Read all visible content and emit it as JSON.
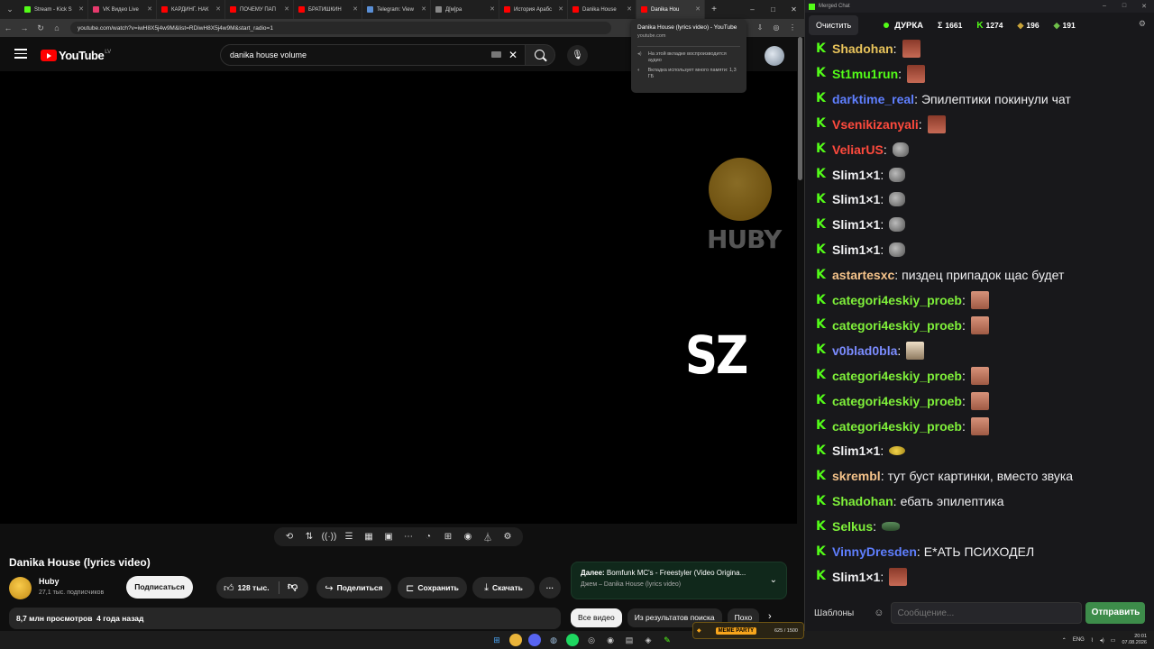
{
  "browser": {
    "tabs": [
      {
        "label": "Stream - Kick S",
        "color": "#53fc18"
      },
      {
        "label": "VK Видео Live",
        "color": "#e63a6d"
      },
      {
        "label": "КАРДИНГ. НАК",
        "color": "#ff0000"
      },
      {
        "label": "ПОЧЕМУ ПАП",
        "color": "#ff0000"
      },
      {
        "label": "БРАТИШКИН",
        "color": "#ff0000"
      },
      {
        "label": "Telegram: View",
        "color": "#5a8fd6"
      },
      {
        "label": "Д[м]ра",
        "color": "#888888"
      },
      {
        "label": "История Арабс",
        "color": "#ff0000"
      },
      {
        "label": "Danika House",
        "color": "#ff0000"
      },
      {
        "label": "Danika Hou",
        "color": "#ff0000"
      }
    ],
    "url": "youtube.com/watch?v=iwH8X5j4w9M&list=RDiwH8X5j4w9M&start_radio=1",
    "tooltip": {
      "title": "Danika House (lyrics video) - YouTube",
      "domain": "youtube.com",
      "audio_note": "На этой вкладке воспроизводится аудио",
      "memory_note": "Вкладка использует много памяти: 1,3 ГБ"
    }
  },
  "youtube": {
    "logo": "YouTube",
    "logo_country": "LV",
    "search_value": "danika house volume",
    "video_overlay": {
      "channel_mark": "HUBY",
      "caption": "SZ"
    },
    "video_title": "Danika House (lyrics video)",
    "channel": {
      "name": "Huby",
      "subscribers": "27,1 тыс. подписчиков"
    },
    "subscribe_label": "Подписаться",
    "likes": "128 тыс.",
    "share_label": "Поделиться",
    "save_label": "Сохранить",
    "download_label": "Скачать",
    "views_line": "8,7 млн просмотров  4 года назад",
    "next": {
      "prefix": "Далее:",
      "title": "Bomfunk MC's - Freestyler (Video Origina...",
      "subtitle": "Джем – Danika House (lyrics video)"
    },
    "chips": [
      "Все видео",
      "Из результатов поиска",
      "Похо"
    ]
  },
  "chat": {
    "window_title": "Merged Chat",
    "clear_label": "Очистить",
    "channel": "ДУРКА",
    "stats": {
      "total": "1661",
      "kick": "1274",
      "twitch": "196",
      "other": "191"
    },
    "messages": [
      {
        "user": "Shadohan",
        "color": "#e9c45b",
        "text": "",
        "emote": "e-face"
      },
      {
        "user": "St1mu1run",
        "color": "#53fc18",
        "text": "",
        "emote": "e-face"
      },
      {
        "user": "darktime_real",
        "color": "#5f7fff",
        "text": "Эпилептики покинули чат",
        "emote": ""
      },
      {
        "user": "Vsenikizanyali",
        "color": "#ff4a3d",
        "text": "",
        "emote": "e-face"
      },
      {
        "user": "VeliarUS",
        "color": "#ff4a3d",
        "text": "",
        "emote": "e-rock"
      },
      {
        "user": "Slim1×1",
        "color": "#efeff1",
        "text": "",
        "emote": "e-rock"
      },
      {
        "user": "Slim1×1",
        "color": "#efeff1",
        "text": "",
        "emote": "e-rock"
      },
      {
        "user": "Slim1×1",
        "color": "#efeff1",
        "text": "",
        "emote": "e-rock"
      },
      {
        "user": "Slim1×1",
        "color": "#efeff1",
        "text": "",
        "emote": "e-rock"
      },
      {
        "user": "astartesxc",
        "color": "#f5c38a",
        "text": "пиздец припадок щас будет",
        "emote": ""
      },
      {
        "user": "categori4eskiy_proeb",
        "color": "#7ff03a",
        "text": "",
        "emote": "e-man"
      },
      {
        "user": "categori4eskiy_proeb",
        "color": "#7ff03a",
        "text": "",
        "emote": "e-man"
      },
      {
        "user": "v0blad0bla",
        "color": "#7b8cff",
        "text": "",
        "emote": "e-girl"
      },
      {
        "user": "categori4eskiy_proeb",
        "color": "#7ff03a",
        "text": "",
        "emote": "e-man"
      },
      {
        "user": "categori4eskiy_proeb",
        "color": "#7ff03a",
        "text": "",
        "emote": "e-man"
      },
      {
        "user": "categori4eskiy_proeb",
        "color": "#7ff03a",
        "text": "",
        "emote": "e-man"
      },
      {
        "user": "Slim1×1",
        "color": "#efeff1",
        "text": "",
        "emote": "e-yellow"
      },
      {
        "user": "skrembl",
        "color": "#f5c38a",
        "text": "тут буст картинки, вместо звука",
        "emote": ""
      },
      {
        "user": "Shadohan",
        "color": "#7ff03a",
        "text": "ебать эпилептика",
        "emote": ""
      },
      {
        "user": "Selkus",
        "color": "#7ff03a",
        "text": "",
        "emote": "e-frog"
      },
      {
        "user": "VinnyDresden",
        "color": "#5f7fff",
        "text": "Е*АТЬ ПСИХОДЕЛ",
        "emote": ""
      },
      {
        "user": "Slim1×1",
        "color": "#efeff1",
        "text": "",
        "emote": "e-face"
      }
    ],
    "templates_label": "Шаблоны",
    "input_placeholder": "Сообщение...",
    "send_label": "Отправить"
  },
  "taskbar": {
    "widget_label": "MEME PARTY",
    "widget_score": "625 / 1500",
    "lang": "ENG",
    "time": "20:01",
    "date": "07.08.2026"
  }
}
